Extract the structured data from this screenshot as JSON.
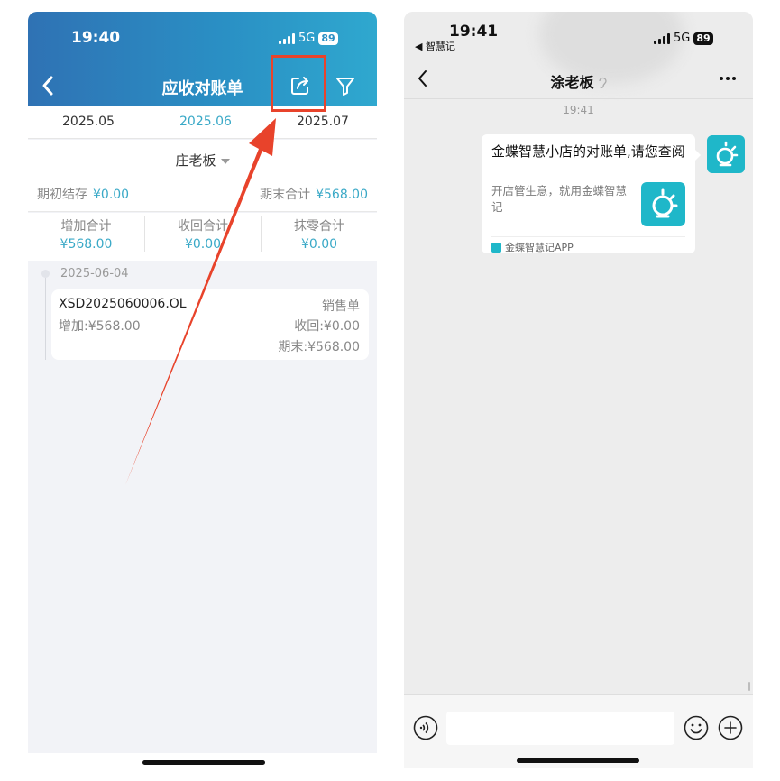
{
  "left": {
    "status": {
      "time": "19:40",
      "network": "5G",
      "battery": "89"
    },
    "nav": {
      "title": "应收对账单"
    },
    "months": [
      "2025.05",
      "2025.06",
      "2025.07"
    ],
    "customer": "庄老板",
    "balance": {
      "opening_label": "期初结存",
      "opening_value": "¥0.00",
      "closing_label": "期末合计",
      "closing_value": "¥568.00"
    },
    "totals": [
      {
        "label": "增加合计",
        "value": "¥568.00"
      },
      {
        "label": "收回合计",
        "value": "¥0.00"
      },
      {
        "label": "抹零合计",
        "value": "¥0.00"
      }
    ],
    "record": {
      "date": "2025-06-04",
      "number": "XSD2025060006.OL",
      "type": "销售单",
      "increase": "增加:¥568.00",
      "recovered": "收回:¥0.00",
      "ending": "期末:¥568.00"
    }
  },
  "right": {
    "status": {
      "time": "19:41",
      "back_app": "◀ 智慧记",
      "network": "5G",
      "battery": "89"
    },
    "chat": {
      "title": "涂老板",
      "time": "19:41"
    },
    "message": {
      "title": "金蝶智慧小店的对账单,请您查阅",
      "description": "开店管生意，就用金蝶智慧记",
      "source": "金蝶智慧记APP"
    }
  },
  "colors": {
    "accent": "#3aa9c7",
    "header_blue": "#2a8fc4",
    "highlight_red": "#e8432b",
    "brand_teal": "#1fb7c9"
  }
}
